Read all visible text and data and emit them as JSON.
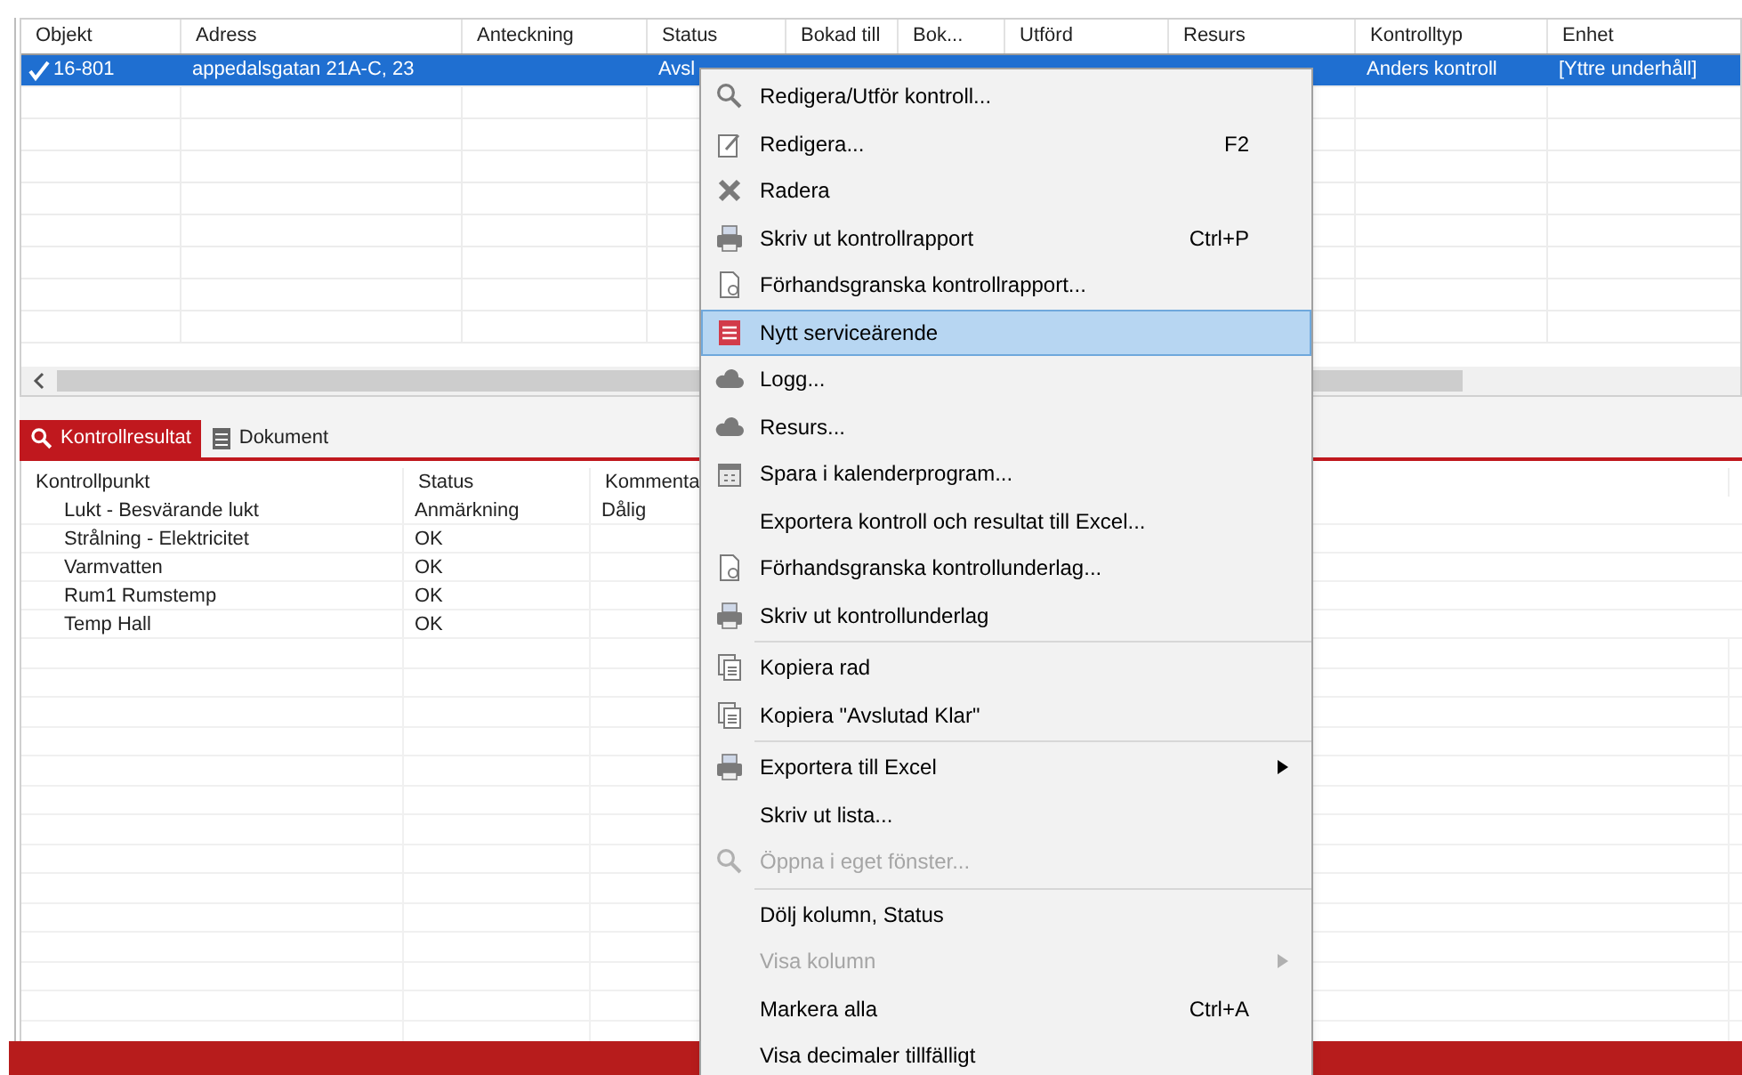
{
  "grid": {
    "columns": [
      "Objekt",
      "Adress",
      "Anteckning",
      "Status",
      "Bokad till",
      "Bok...",
      "Utförd",
      "Resurs",
      "Kontrolltyp",
      "Enhet"
    ],
    "rows": [
      {
        "selected": true,
        "checked": true,
        "cells": {
          "objekt": "16-801",
          "adress": "appedalsgatan 21A-C, 23",
          "status": "Avsl",
          "kontrolltyp": "Anders kontroll",
          "enhet": "[Yttre underhåll]"
        }
      }
    ]
  },
  "tabs": [
    {
      "label": "Kontrollresultat",
      "selected": true
    },
    {
      "label": "Dokument",
      "selected": false
    }
  ],
  "results": {
    "columns": [
      "Kontrollpunkt",
      "Status",
      "Kommenta"
    ],
    "rows": [
      {
        "point": "Lukt - Besvärande lukt",
        "status": "Anmärkning",
        "comment": "Dålig"
      },
      {
        "point": "Strålning - Elektricitet",
        "status": "OK"
      },
      {
        "point": "Varmvatten",
        "status": "OK"
      },
      {
        "point": "Rum1 Rumstemp",
        "status": "OK"
      },
      {
        "point": "Temp Hall",
        "status": "OK"
      }
    ]
  },
  "context_menu": {
    "groups": [
      [
        {
          "label": "Redigera/Utför kontroll...",
          "selected": false,
          "disabled": false,
          "submenu": false
        },
        {
          "label": "Redigera...",
          "shortcut": "F2",
          "selected": false,
          "disabled": false,
          "submenu": false
        },
        {
          "label": "Radera",
          "selected": false,
          "disabled": false,
          "submenu": false
        },
        {
          "label": "Skriv ut kontrollrapport",
          "shortcut": "Ctrl+P",
          "selected": false,
          "disabled": false,
          "submenu": false
        },
        {
          "label": "Förhandsgranska kontrollrapport...",
          "selected": false,
          "disabled": false,
          "submenu": false
        },
        {
          "label": "Nytt serviceärende",
          "selected": true,
          "disabled": false,
          "submenu": false
        },
        {
          "label": "Logg...",
          "selected": false,
          "disabled": false,
          "submenu": false
        },
        {
          "label": "Resurs...",
          "selected": false,
          "disabled": false,
          "submenu": false
        },
        {
          "label": "Spara i kalenderprogram...",
          "selected": false,
          "disabled": false,
          "submenu": false
        },
        {
          "label": "Exportera kontroll och resultat till Excel...",
          "selected": false,
          "disabled": false,
          "submenu": false
        },
        {
          "label": "Förhandsgranska kontrollunderlag...",
          "selected": false,
          "disabled": false,
          "submenu": false
        },
        {
          "label": "Skriv ut kontrollunderlag",
          "selected": false,
          "disabled": false,
          "submenu": false
        }
      ],
      [
        {
          "label": "Kopiera rad",
          "selected": false,
          "disabled": false,
          "submenu": false
        },
        {
          "label": "Kopiera \"Avslutad Klar\"",
          "selected": false,
          "disabled": false,
          "submenu": false
        }
      ],
      [
        {
          "label": "Exportera till Excel",
          "selected": false,
          "disabled": false,
          "submenu": true
        },
        {
          "label": "Skriv ut lista...",
          "selected": false,
          "disabled": false,
          "submenu": false
        },
        {
          "label": "Öppna i eget fönster...",
          "selected": false,
          "disabled": true,
          "submenu": false
        }
      ],
      [
        {
          "label": "Dölj kolumn, Status",
          "selected": false,
          "disabled": false,
          "submenu": false
        },
        {
          "label": "Visa kolumn",
          "selected": false,
          "disabled": true,
          "submenu": true
        },
        {
          "label": "Markera alla",
          "shortcut": "Ctrl+A",
          "selected": false,
          "disabled": false,
          "submenu": false
        },
        {
          "label": "Visa decimaler tillfälligt",
          "selected": false,
          "disabled": false,
          "submenu": false
        }
      ]
    ]
  }
}
